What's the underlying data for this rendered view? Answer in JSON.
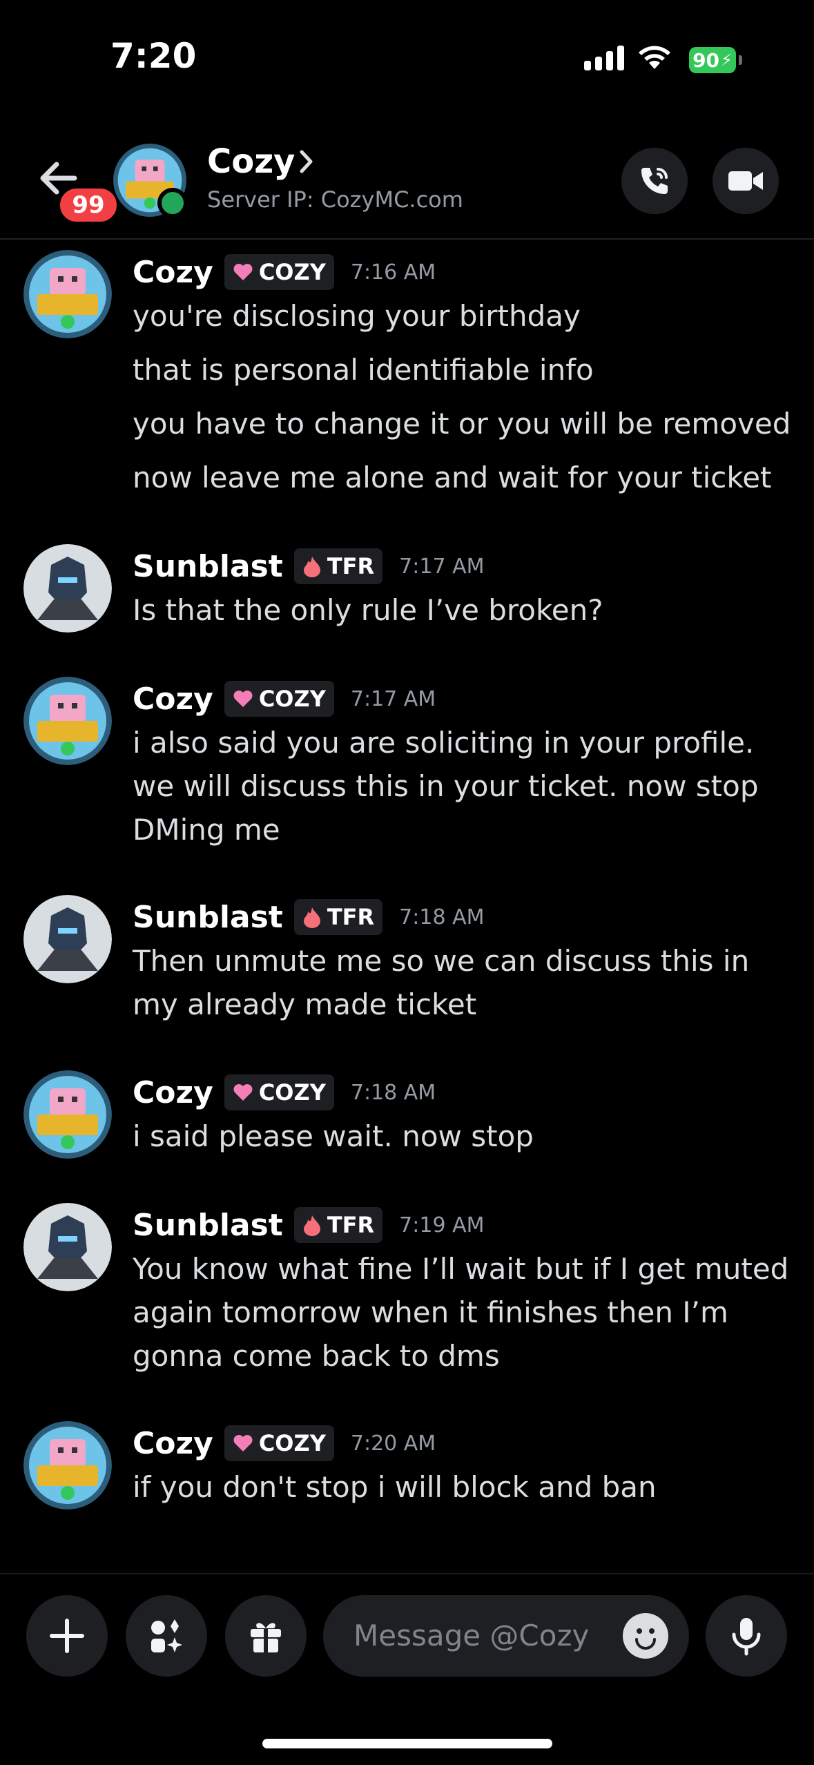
{
  "status_bar": {
    "time": "7:20",
    "battery": "90"
  },
  "header": {
    "unread_badge": "99",
    "name": "Cozy",
    "subtitle": "Server IP: CozyMC.com",
    "back_icon": "arrow-left-icon",
    "call_icon": "phone-icon",
    "video_icon": "video-camera-icon"
  },
  "messages": [
    {
      "author": "Cozy",
      "tag": "COZY",
      "time": "7:16 AM",
      "lines": [
        "you're disclosing your birthday",
        "that is personal identifiable info",
        "you have to change it or you will be removed",
        "now leave me alone and wait for your ticket"
      ]
    },
    {
      "author": "Sunblast",
      "tag": "TFR",
      "time": "7:17 AM",
      "lines": [
        "Is that the only rule I’ve broken?"
      ]
    },
    {
      "author": "Cozy",
      "tag": "COZY",
      "time": "7:17 AM",
      "lines": [
        "i also said you are soliciting in your profile. we will discuss this in your ticket. now stop DMing me"
      ]
    },
    {
      "author": "Sunblast",
      "tag": "TFR",
      "time": "7:18 AM",
      "lines": [
        "Then unmute me so we can discuss this in my already made ticket"
      ]
    },
    {
      "author": "Cozy",
      "tag": "COZY",
      "time": "7:18 AM",
      "lines": [
        "i said please wait. now stop"
      ]
    },
    {
      "author": "Sunblast",
      "tag": "TFR",
      "time": "7:19 AM",
      "lines": [
        "You know what fine I’ll wait but if I get muted again tomorrow when it finishes then I’m gonna come back to dms"
      ]
    },
    {
      "author": "Cozy",
      "tag": "COZY",
      "time": "7:20 AM",
      "lines": [
        "if you don't stop i will block and ban"
      ]
    }
  ],
  "composer": {
    "placeholder": "Message @Cozy",
    "plus_icon": "plus-icon",
    "apps_icon": "apps-icon",
    "gift_icon": "gift-icon",
    "emoji_icon": "emoji-icon",
    "mic_icon": "microphone-icon"
  },
  "colors": {
    "background": "#000000",
    "online": "#23a55a",
    "badge": "#f23f43",
    "battery": "#34c759"
  }
}
